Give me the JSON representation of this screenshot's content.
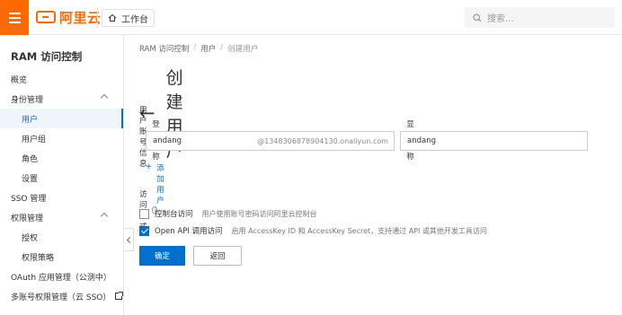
{
  "header": {
    "logo_text": "阿里云",
    "workbench_label": "工作台",
    "search_placeholder": "搜索...",
    "accent_color": "#ff6a00"
  },
  "sidebar": {
    "title": "RAM 访问控制",
    "items": [
      {
        "label": "概览"
      },
      {
        "label": "身份管理"
      },
      {
        "label": "用户"
      },
      {
        "label": "用户组"
      },
      {
        "label": "角色"
      },
      {
        "label": "设置"
      },
      {
        "label": "SSO 管理"
      },
      {
        "label": "权限管理"
      },
      {
        "label": "授权"
      },
      {
        "label": "权限策略"
      },
      {
        "label": "OAuth 应用管理（公测中）"
      },
      {
        "label": "多账号权限管理（云 SSO）"
      }
    ]
  },
  "breadcrumb": {
    "items": [
      "RAM 访问控制",
      "用户",
      "创建用户"
    ],
    "sep": "/"
  },
  "page": {
    "title": "创建用户",
    "back_icon": "arrow-left-icon"
  },
  "form": {
    "section_label": "用户账号信息",
    "login_name_label": "登录名称",
    "display_name_label": "显示名称",
    "login_name_value": "andang",
    "login_name_suffix": "@1348306878904130.onaliyun.com",
    "display_name_value": "andang",
    "add_user_label": "添加用户",
    "access_label": "访问方式",
    "console_access_label": "控制台访问",
    "console_access_desc": "用户使用账号密码访问阿里云控制台",
    "api_access_label": "Open API 调用访问",
    "api_access_desc": "启用 AccessKey ID 和 AccessKey Secret，支持通过 API 或其他开发工具访问",
    "confirm_label": "确定",
    "back_label": "返回",
    "primary_color": "#0070cc"
  }
}
